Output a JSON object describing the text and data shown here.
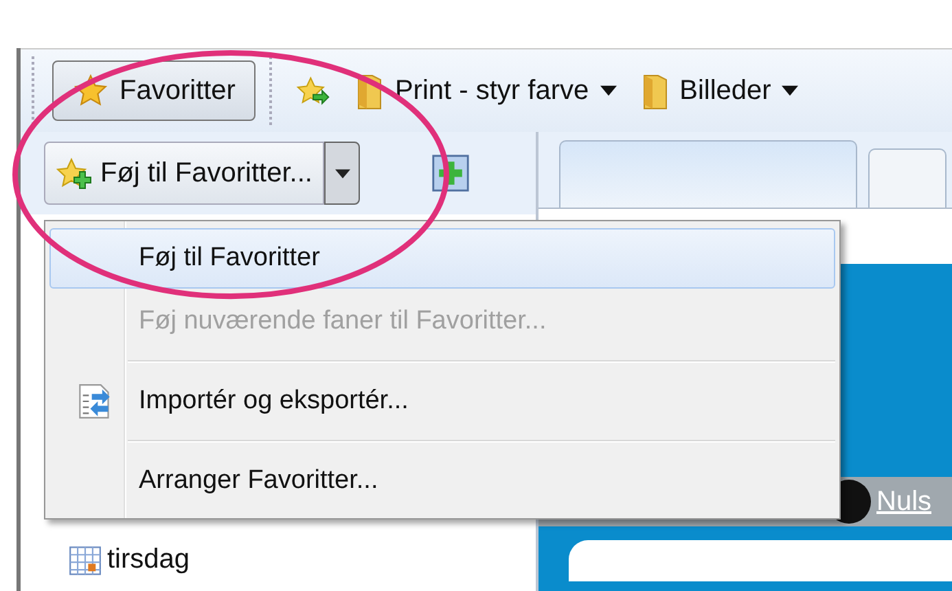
{
  "toolbar": {
    "favorites_button": "Favoritter",
    "links": [
      {
        "kind": "add"
      },
      {
        "kind": "folder",
        "label": "Print - styr farve",
        "has_menu": true
      },
      {
        "kind": "folder",
        "label": "Billeder",
        "has_menu": true
      }
    ]
  },
  "panel": {
    "add_button": "Føj til Favoritter...",
    "items": [
      {
        "label": "tirsdag"
      }
    ]
  },
  "menu": {
    "items": [
      {
        "kind": "item",
        "label": "Føj til Favoritter",
        "selected": true,
        "disabled": false,
        "has_icon": false
      },
      {
        "kind": "item",
        "label": "Føj nuværende faner til Favoritter...",
        "selected": false,
        "disabled": true,
        "has_icon": false
      },
      {
        "kind": "separator"
      },
      {
        "kind": "item",
        "label": "Importér og eksportér...",
        "selected": false,
        "disabled": false,
        "has_icon": true
      },
      {
        "kind": "separator"
      },
      {
        "kind": "item",
        "label": "Arranger Favoritter...",
        "selected": false,
        "disabled": false,
        "has_icon": false
      }
    ]
  },
  "content": {
    "link": "Nuls"
  }
}
